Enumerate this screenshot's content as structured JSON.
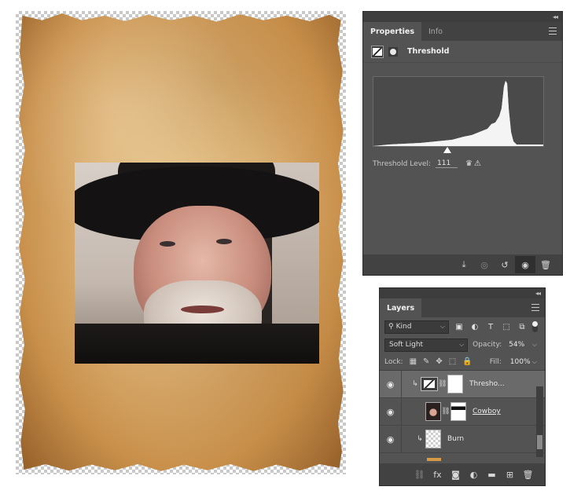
{
  "document": {
    "image_alt": "Cowboy photo on aged parchment"
  },
  "properties_panel": {
    "collapse_glyph": "◂◂",
    "tabs": [
      {
        "label": "Properties",
        "active": true
      },
      {
        "label": "Info",
        "active": false
      }
    ],
    "adjustment_title": "Threshold",
    "threshold_level_label": "Threshold Level:",
    "threshold_level_value": "111",
    "footer_icons": [
      "clip-to-layer-icon",
      "view-previous-icon",
      "reset-icon",
      "visibility-icon",
      "trash-icon"
    ]
  },
  "layers_panel": {
    "collapse_glyph": "◂◂",
    "tabs": [
      {
        "label": "Layers",
        "active": true
      }
    ],
    "filter_kind": "Kind",
    "blend_mode": "Soft Light",
    "opacity_label": "Opacity:",
    "opacity_value": "54%",
    "lock_label": "Lock:",
    "fill_label": "Fill:",
    "fill_value": "100%",
    "layers": [
      {
        "name": "Thresho...",
        "type": "adjustment",
        "selected": true
      },
      {
        "name": "Cowboy",
        "type": "photo",
        "selected": false
      },
      {
        "name": "Burn",
        "type": "empty",
        "selected": false
      }
    ],
    "footer_icons": [
      "link-icon",
      "fx-icon",
      "mask-icon",
      "adjustment-icon",
      "group-icon",
      "new-layer-icon",
      "trash-icon"
    ],
    "fx_label": "fx"
  },
  "colors": {
    "panel_bg": "#535353",
    "panel_dark": "#424242",
    "parchment": "#ddb478",
    "accent_orange": "#d79b45"
  }
}
